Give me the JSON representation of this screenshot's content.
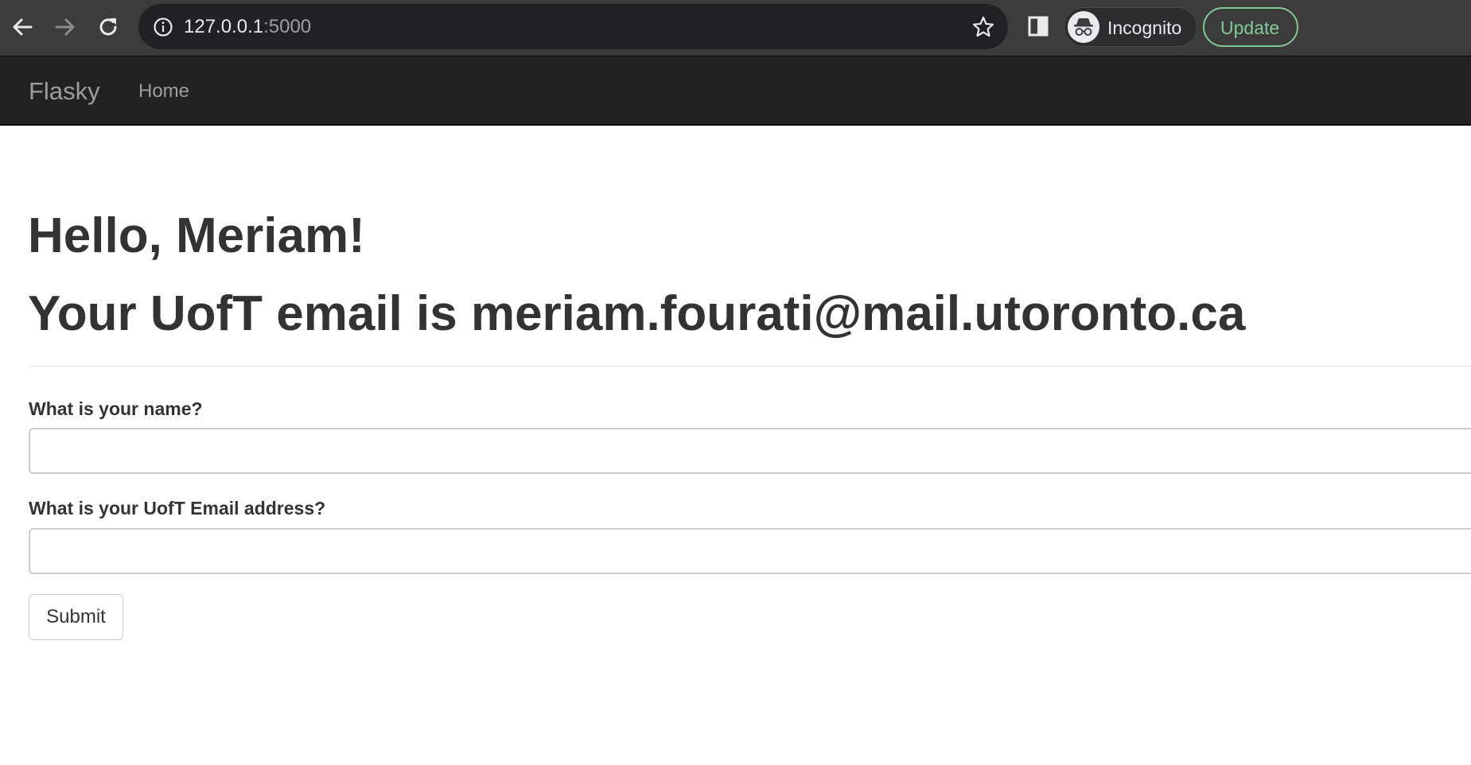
{
  "browser": {
    "url_host": "127.0.0.1",
    "url_port": ":5000",
    "profile_label": "Incognito",
    "update_label": "Update",
    "accent_update": "#81c995"
  },
  "navbar": {
    "brand": "Flasky",
    "links": [
      {
        "label": "Home"
      }
    ]
  },
  "page": {
    "greeting": "Hello, Meriam!",
    "email_line": "Your UofT email is meriam.fourati@mail.utoronto.ca"
  },
  "form": {
    "name_label": "What is your name?",
    "name_value": "",
    "email_label": "What is your UofT Email address?",
    "email_value": "",
    "submit_label": "Submit"
  },
  "icons": {
    "back": "back-arrow-icon",
    "forward": "forward-arrow-icon",
    "reload": "reload-icon",
    "site_info": "info-icon",
    "bookmark": "star-icon",
    "side_panel": "side-panel-icon",
    "incognito": "incognito-icon"
  }
}
